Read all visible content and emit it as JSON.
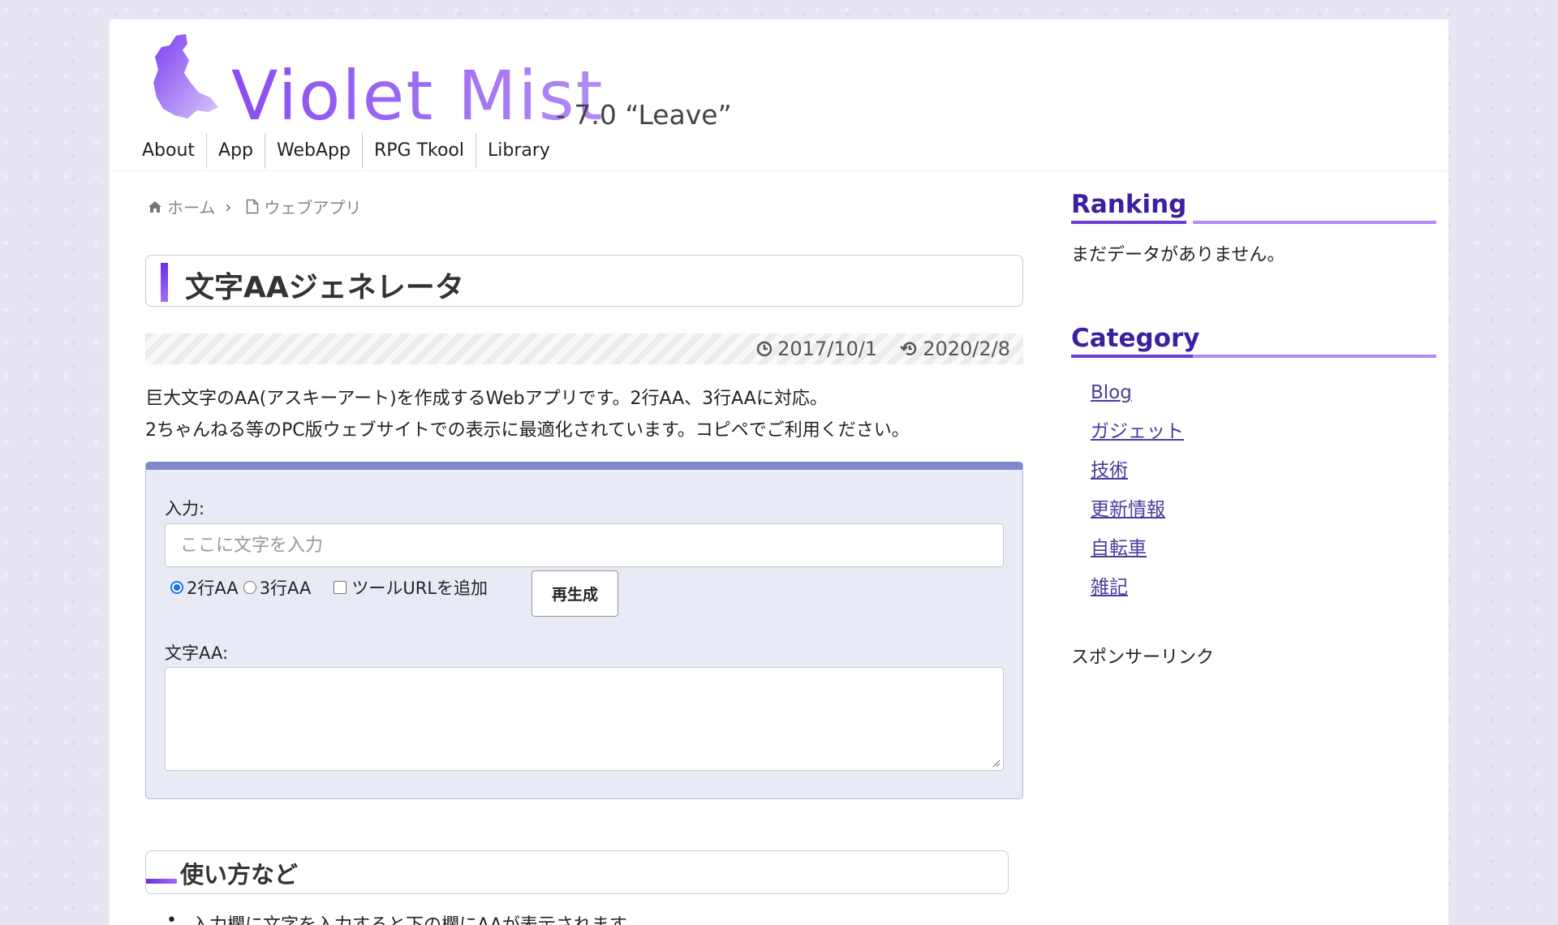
{
  "site": {
    "title": "Violet Mist",
    "subtitle": "- 7.0 “Leave”"
  },
  "nav": [
    "About",
    "App",
    "WebApp",
    "RPG Tkool",
    "Library"
  ],
  "breadcrumb": {
    "home": "ホーム",
    "current": "ウェブアプリ"
  },
  "article": {
    "title": "文字AAジェネレータ",
    "published": "2017/10/1",
    "updated": "2020/2/8",
    "intro_line1": "巨大文字のAA(アスキーアート)を作成するWebアプリです。2行AA、3行AAに対応。",
    "intro_line2": "2ちゃんねる等のPC版ウェブサイトでの表示に最適化されています。コピペでご利用ください。"
  },
  "tool": {
    "input_label": "入力:",
    "input_placeholder": "ここに文字を入力",
    "input_value": "",
    "option_2line": "2行AA",
    "option_3line": "3行AA",
    "option_url": "ツールURLを追加",
    "selected": "2行AA",
    "regen_button": "再生成",
    "output_label": "文字AA:",
    "output_value": ""
  },
  "usage": {
    "heading": "使い方など",
    "bullet1": "入力欄に文字を入力すると下の欄にAAが表示されます"
  },
  "sidebar": {
    "ranking_title": "Ranking",
    "ranking_empty": "まだデータがありません。",
    "category_title": "Category",
    "categories": [
      "Blog",
      "ガジェット",
      "技術",
      "更新情報",
      "自転車",
      "雑記"
    ],
    "sponsor": "スポンサーリンク"
  },
  "colors": {
    "accent": "#6a2ee8",
    "tool_border": "#7f89cc",
    "link": "#4a3b9c"
  }
}
